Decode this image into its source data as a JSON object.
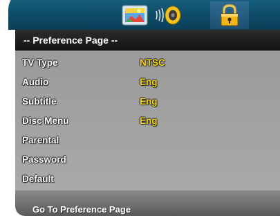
{
  "top_icons": [
    {
      "icon": "picture-icon"
    },
    {
      "icon": "audio-speaker-icon"
    },
    {
      "icon": "lock-icon"
    }
  ],
  "header": {
    "title": "-- Preference Page --"
  },
  "menu": {
    "items": [
      {
        "label": "TV Type",
        "value": "NTSC"
      },
      {
        "label": "Audio",
        "value": "Eng"
      },
      {
        "label": "Subtitle",
        "value": "Eng"
      },
      {
        "label": "Disc Menu",
        "value": "Eng"
      },
      {
        "label": "Parental",
        "value": ""
      },
      {
        "label": "Password",
        "value": ""
      },
      {
        "label": "Default",
        "value": ""
      }
    ]
  },
  "status": {
    "text": "Go To Preference Page"
  },
  "colors": {
    "topbar": "#0f4f6c",
    "titlebar": "#1a1a1a",
    "menu_bg": "#a0a0a0",
    "value_text": "#f2d515",
    "label_text": "#ffffff"
  }
}
